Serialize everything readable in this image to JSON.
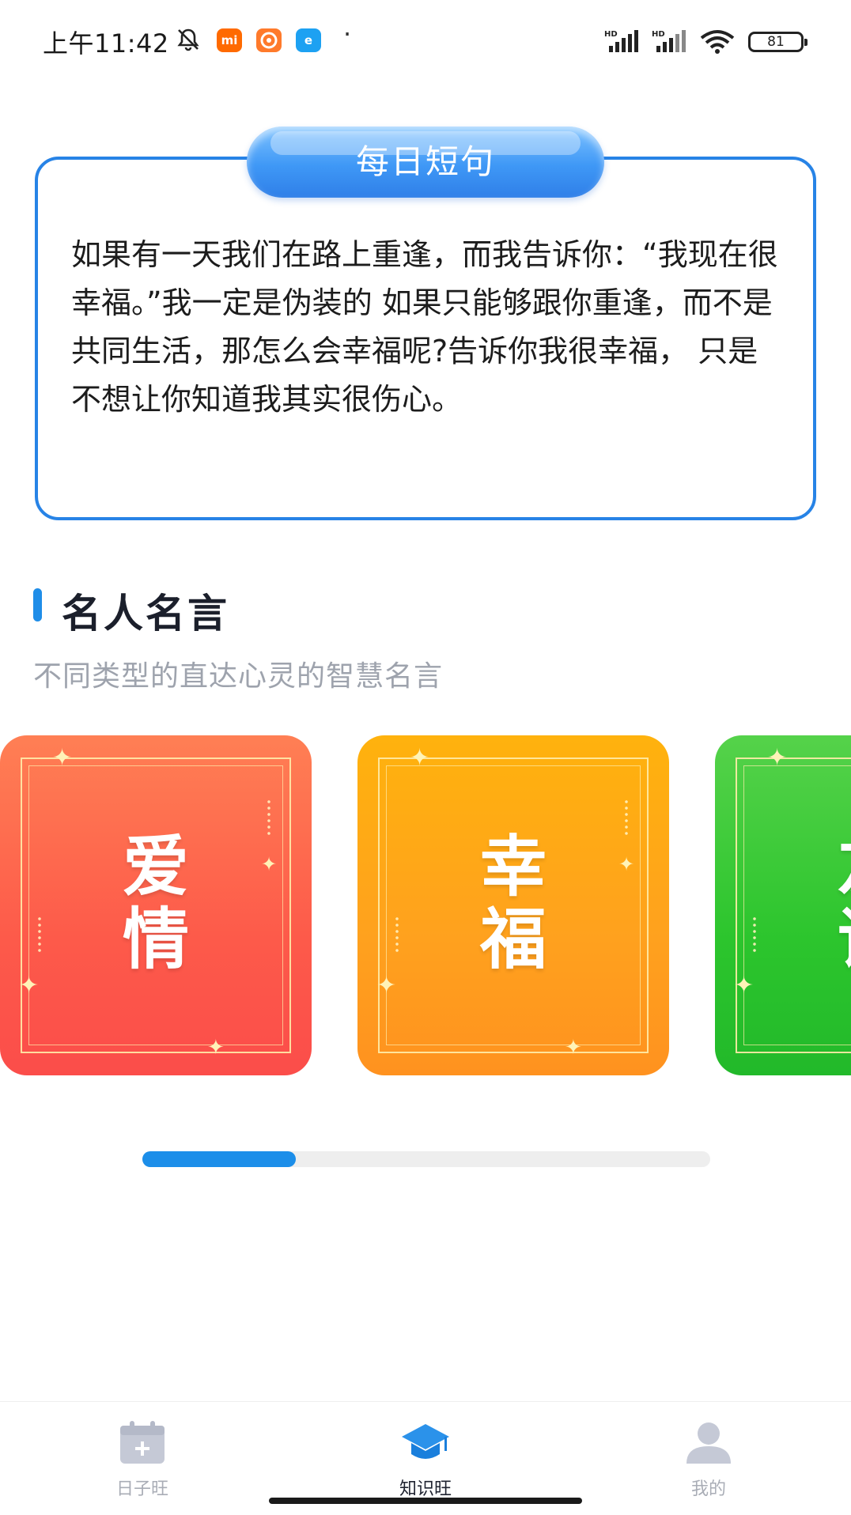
{
  "status_bar": {
    "time": "上午11:42",
    "app_icons": [
      {
        "name": "mi-app-icon",
        "label": "mi",
        "color": "#ff6a00"
      },
      {
        "name": "orange-app-icon",
        "label": "",
        "color": "#ff7a2b"
      },
      {
        "name": "e-app-icon",
        "label": "e",
        "color": "#1da1f2"
      }
    ],
    "battery": "81"
  },
  "daily": {
    "title": "每日短句",
    "text": "如果有一天我们在路上重逢，而我告诉你：“我现在很幸福。”我一定是伪装的 如果只能够跟你重逢，而不是共同生活，那怎么会幸福呢?告诉你我很幸福， 只是不想让你知道我其实很伤心。",
    "border_color": "#2783e6"
  },
  "quotes_section": {
    "title": "名人名言",
    "subtitle": "不同类型的直达心灵的智慧名言",
    "accent": "#1f8de8",
    "categories": [
      {
        "label": "爱情",
        "color": "#fd5a4a"
      },
      {
        "label": "幸福",
        "color": "#ffa11e"
      },
      {
        "label": "友谊",
        "color": "#2cc52d"
      }
    ],
    "scroll_progress": 0.27
  },
  "tabbar": {
    "tabs": [
      {
        "label": "日子旺",
        "icon": "calendar-icon",
        "active": false
      },
      {
        "label": "知识旺",
        "icon": "graduation-cap-icon",
        "active": true
      },
      {
        "label": "我的",
        "icon": "user-icon",
        "active": false
      }
    ]
  }
}
